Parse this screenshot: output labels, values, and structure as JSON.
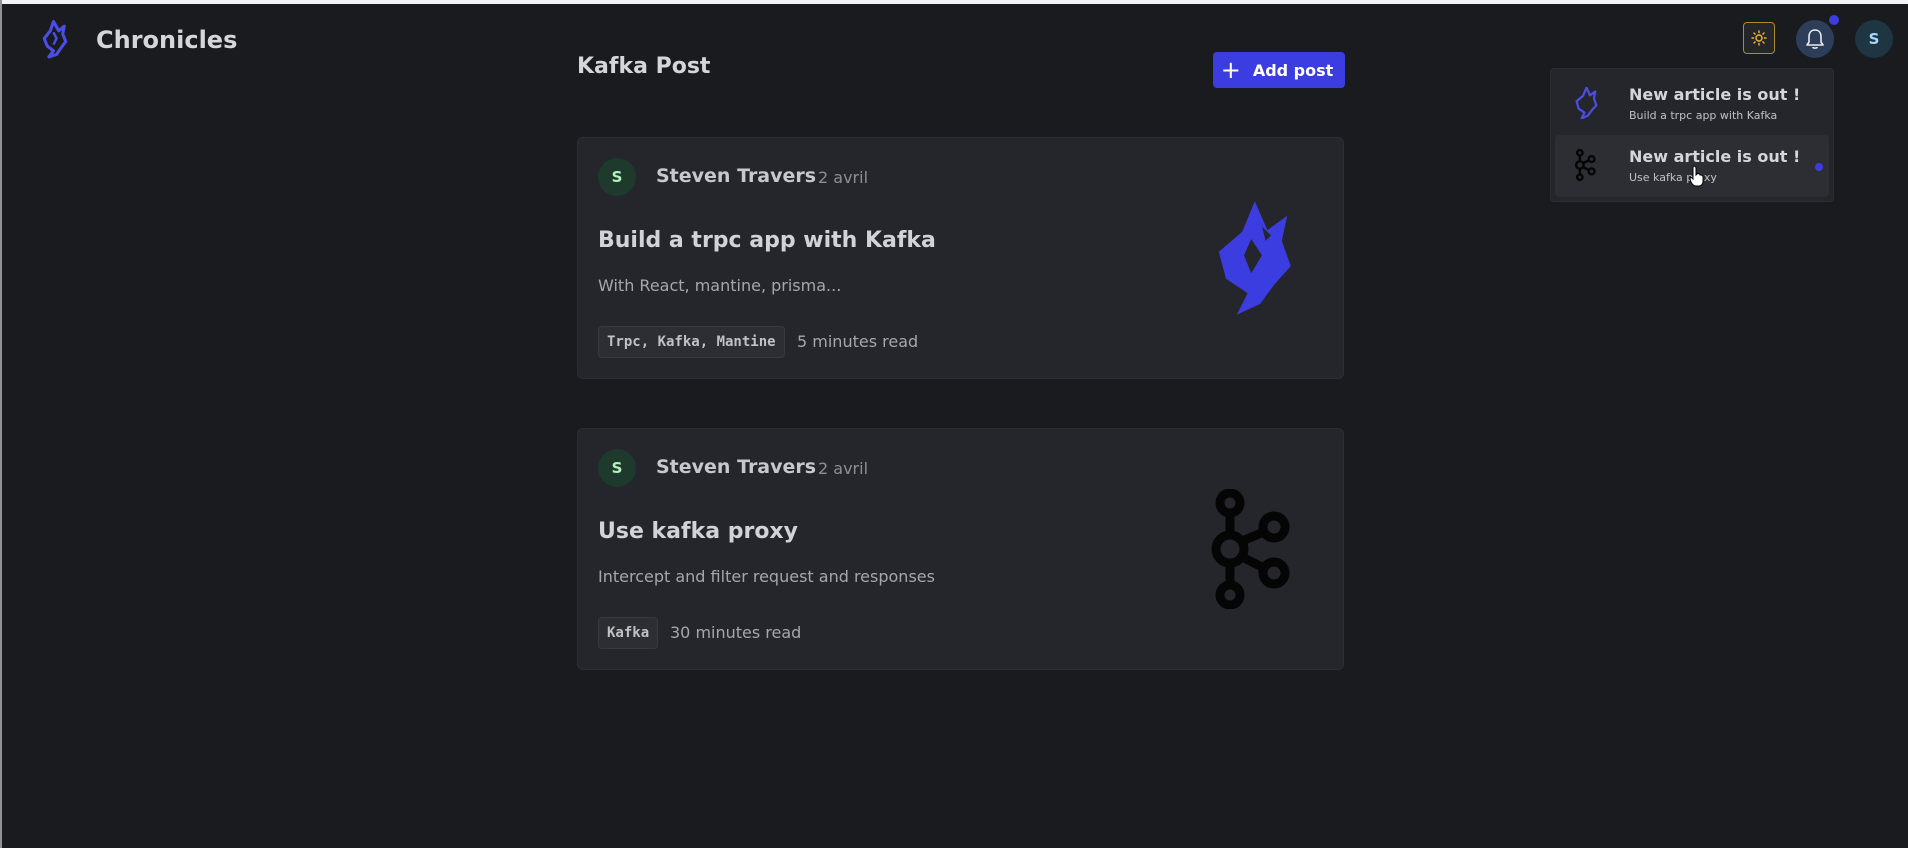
{
  "app": {
    "name": "Chronicles"
  },
  "page": {
    "title": "Kafka Post",
    "add_post_label": "Add post"
  },
  "colors": {
    "accent": "#3b3de0",
    "background": "#1a1b1e",
    "card": "#25262b"
  },
  "header": {
    "user_initial": "S",
    "theme_icon": "sun-icon",
    "notifications_icon": "bell-icon"
  },
  "posts": [
    {
      "author_initial": "S",
      "author": "Steven Travers",
      "date": "2 avril",
      "title": "Build a trpc app with Kafka",
      "description": "With React, mantine, prisma...",
      "tags": "Trpc, Kafka, Mantine",
      "read_time": "5 minutes read",
      "image_icon": "wolf-logo-icon"
    },
    {
      "author_initial": "S",
      "author": "Steven Travers",
      "date": "2 avril",
      "title": "Use kafka proxy",
      "description": "Intercept and filter request and responses",
      "tags": "Kafka",
      "read_time": "30 minutes read",
      "image_icon": "kafka-logo-icon"
    }
  ],
  "notifications": [
    {
      "title": "New article is out !",
      "subtitle": "Build a trpc app with Kafka",
      "icon": "wolf-logo-icon",
      "unread": false
    },
    {
      "title": "New article is out !",
      "subtitle": "Use kafka proxy",
      "icon": "kafka-logo-icon",
      "unread": true
    }
  ]
}
